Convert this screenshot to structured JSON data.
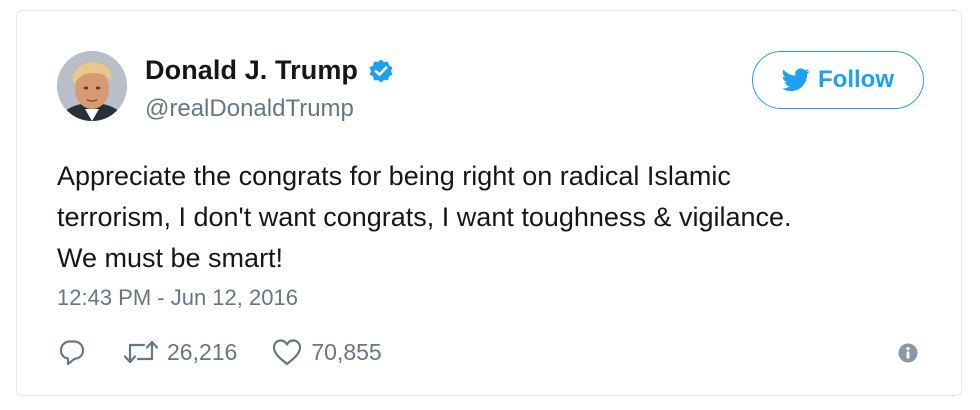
{
  "user": {
    "display_name": "Donald J. Trump",
    "handle": "@realDonaldTrump",
    "verified": true,
    "avatar": "profile-photo"
  },
  "follow_button": {
    "label": "Follow",
    "icon": "twitter-bird-icon"
  },
  "tweet": {
    "text": "Appreciate the congrats for being right on radical Islamic\nterrorism, I don't want congrats, I want toughness & vigilance.\nWe must be smart!",
    "timestamp": "12:43 PM - Jun 12, 2016"
  },
  "actions": {
    "reply_icon": "reply-icon",
    "retweet_icon": "retweet-icon",
    "retweet_count": "26,216",
    "like_icon": "heart-icon",
    "like_count": "70,855",
    "info_icon": "info-icon"
  },
  "colors": {
    "accent": "#1da1f2",
    "text": "#14171a",
    "secondary": "#657786",
    "border": "#e1e8ed"
  }
}
